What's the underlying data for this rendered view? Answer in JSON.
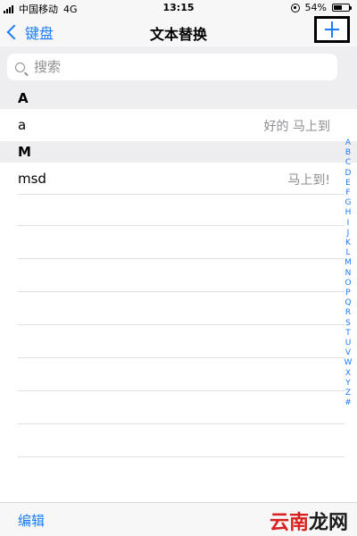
{
  "status_bar": {
    "carrier": "中国移动",
    "network": "4G",
    "time": "13:15",
    "battery": "54%",
    "battery_level": 0.54
  },
  "nav": {
    "back_label": "键盘",
    "title": "文本替换",
    "add_icon": "plus-icon"
  },
  "search": {
    "placeholder": "搜索",
    "value": ""
  },
  "sections": [
    {
      "header": "A",
      "rows": [
        {
          "phrase": "a",
          "shortcut": "好的 马上到"
        }
      ]
    },
    {
      "header": "M",
      "rows": [
        {
          "phrase": "msd",
          "shortcut": "马上到!"
        }
      ]
    }
  ],
  "index_letters": [
    "A",
    "B",
    "C",
    "D",
    "E",
    "F",
    "G",
    "H",
    "I",
    "J",
    "K",
    "L",
    "M",
    "N",
    "O",
    "P",
    "Q",
    "R",
    "S",
    "T",
    "U",
    "V",
    "W",
    "X",
    "Y",
    "Z",
    "#"
  ],
  "toolbar": {
    "edit_label": "编辑"
  },
  "watermark": {
    "part1": "云南",
    "part2": "龙网"
  },
  "colors": {
    "accent": "#1a7cf6",
    "secondary_text": "#8e8e93",
    "section_bg": "#eeeef0"
  }
}
